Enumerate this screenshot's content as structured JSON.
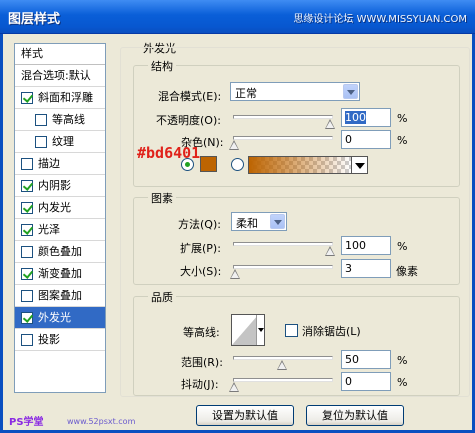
{
  "window": {
    "title": "图层样式",
    "watermark": "思缘设计论坛 WWW.MISSYUAN.COM"
  },
  "styles_list": {
    "header": "样式",
    "blend_options": "混合选项:默认",
    "items": [
      {
        "label": "斜面和浮雕",
        "checked": true,
        "indent": false
      },
      {
        "label": "等高线",
        "checked": false,
        "indent": true
      },
      {
        "label": "纹理",
        "checked": false,
        "indent": true
      },
      {
        "label": "描边",
        "checked": false,
        "indent": false
      },
      {
        "label": "内阴影",
        "checked": true,
        "indent": false
      },
      {
        "label": "内发光",
        "checked": true,
        "indent": false
      },
      {
        "label": "光泽",
        "checked": true,
        "indent": false
      },
      {
        "label": "颜色叠加",
        "checked": false,
        "indent": false
      },
      {
        "label": "渐变叠加",
        "checked": true,
        "indent": false
      },
      {
        "label": "图案叠加",
        "checked": false,
        "indent": false
      },
      {
        "label": "外发光",
        "checked": true,
        "indent": false,
        "selected": true
      },
      {
        "label": "投影",
        "checked": false,
        "indent": false
      }
    ]
  },
  "panel": {
    "title": "外发光",
    "structure": {
      "legend": "结构",
      "blend_mode_label": "混合模式(E):",
      "blend_mode_value": "正常",
      "opacity_label": "不透明度(O):",
      "opacity_value": "100",
      "opacity_unit": "%",
      "opacity_level": 1.0,
      "noise_label": "杂色(N):",
      "noise_value": "0",
      "noise_unit": "%",
      "noise_level": 0.0,
      "annotation": "#bd6401",
      "glow_color": "#bd6401",
      "color_mode": "solid"
    },
    "elements": {
      "legend": "图素",
      "method_label": "方法(Q):",
      "method_value": "柔和",
      "spread_label": "扩展(P):",
      "spread_value": "100",
      "spread_unit": "%",
      "spread_level": 1.0,
      "size_label": "大小(S):",
      "size_value": "3",
      "size_unit": "像素",
      "size_level": 0.012
    },
    "quality": {
      "legend": "品质",
      "contour_label": "等高线:",
      "antialias_label": "消除锯齿(L)",
      "antialias_checked": false,
      "range_label": "范围(R):",
      "range_value": "50",
      "range_unit": "%",
      "range_level": 0.5,
      "jitter_label": "抖动(J):",
      "jitter_value": "0",
      "jitter_unit": "%",
      "jitter_level": 0.0
    },
    "buttons": {
      "set_default": "设置为默认值",
      "reset_default": "复位为默认值"
    }
  },
  "footer": {
    "watermark": "PS学堂",
    "watermark_url": "www.52psxt.com"
  }
}
